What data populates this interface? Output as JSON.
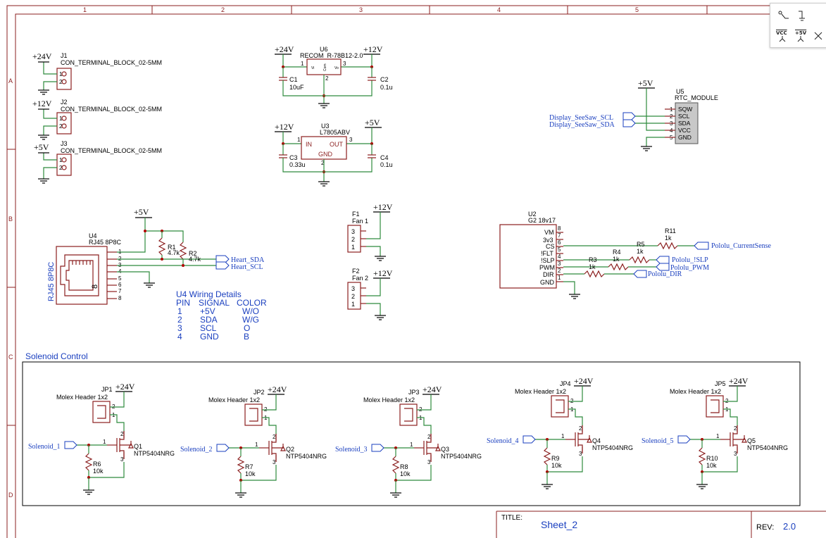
{
  "ruler": {
    "columns": [
      "1",
      "2",
      "3",
      "4",
      "5"
    ],
    "rows": [
      "A",
      "B",
      "C",
      "D"
    ]
  },
  "power_terminals": [
    {
      "ref": "J1",
      "value": "CON_TERMINAL_BLOCK_02-5MM",
      "net": "+24V",
      "pins": [
        "1",
        "2"
      ]
    },
    {
      "ref": "J2",
      "value": "CON_TERMINAL_BLOCK_02-5MM",
      "net": "+12V",
      "pins": [
        "1",
        "2"
      ]
    },
    {
      "ref": "J3",
      "value": "CON_TERMINAL_BLOCK_02-5MM",
      "net": "+5V",
      "pins": [
        "1",
        "2"
      ]
    }
  ],
  "regulator_u6": {
    "ref": "U6",
    "value": "RECOM_R-78B12-2.0",
    "in_net": "+24V",
    "out_net": "+12V",
    "pin_in": "1",
    "pin_out": "3",
    "pin_gnd": "2",
    "pin_label_in": "Vi",
    "pin_label_com": "Com",
    "pin_label_out": "Vo",
    "c_in": {
      "ref": "C1",
      "value": "10uF"
    },
    "c_out": {
      "ref": "C2",
      "value": "0.1u"
    }
  },
  "regulator_u3": {
    "ref": "U3",
    "value": "L7805ABV",
    "in_net": "+12V",
    "out_net": "+5V",
    "pin_in": "1",
    "pin_out": "3",
    "pin_gnd": "2",
    "label_in": "IN",
    "label_out": "OUT",
    "label_gnd": "GND",
    "c_in": {
      "ref": "C3",
      "value": "0.33u"
    },
    "c_out": {
      "ref": "C4",
      "value": "0.1u"
    }
  },
  "rtc": {
    "ref": "U5",
    "value": "RTC_MODULE",
    "net": "+5V",
    "pins": [
      {
        "num": "1",
        "name": "SQW"
      },
      {
        "num": "2",
        "name": "SCL"
      },
      {
        "num": "3",
        "name": "SDA"
      },
      {
        "num": "4",
        "name": "VCC"
      },
      {
        "num": "5",
        "name": "GND"
      }
    ],
    "labels": [
      "Display_SeeSaw_SCL",
      "Display_SeeSaw_SDA"
    ]
  },
  "rj45": {
    "ref": "U4",
    "value": "RJ45 8P8C",
    "side_label": "RJ45 8P8C",
    "body_num": "8",
    "pins": [
      "1",
      "2",
      "3",
      "4",
      "5",
      "6",
      "7",
      "8"
    ],
    "net": "+5V",
    "r1": {
      "ref": "R1",
      "value": "4.7k"
    },
    "r2": {
      "ref": "R2",
      "value": "4.7k"
    },
    "labels": [
      "Heart_SDA",
      "Heart_SCL"
    ]
  },
  "wiring_table": {
    "title": "U4 Wiring Details",
    "headers": [
      "PIN",
      "SIGNAL",
      "COLOR"
    ],
    "rows": [
      [
        "1",
        "+5V",
        "W/O"
      ],
      [
        "2",
        "SDA",
        "W/G"
      ],
      [
        "3",
        "SCL",
        "O"
      ],
      [
        "4",
        "GND",
        "B"
      ]
    ]
  },
  "fans": [
    {
      "ref": "F1",
      "value": "Fan 1",
      "net": "+12V",
      "pins": [
        "3",
        "2",
        "1"
      ]
    },
    {
      "ref": "F2",
      "value": "Fan 2",
      "net": "+12V",
      "pins": [
        "3",
        "2",
        "1"
      ]
    }
  ],
  "driver": {
    "ref": "U2",
    "value": "G2 18v17",
    "pins": [
      {
        "name": "VM",
        "num": "8"
      },
      {
        "name": "3v3",
        "num": "7"
      },
      {
        "name": "CS",
        "num": "6"
      },
      {
        "name": "!FLT",
        "num": "5"
      },
      {
        "name": "!SLP",
        "num": "4"
      },
      {
        "name": "PWM",
        "num": "3"
      },
      {
        "name": "DIR",
        "num": "2"
      },
      {
        "name": "GND",
        "num": "1"
      }
    ],
    "resistors": [
      {
        "ref": "R11",
        "value": "1k"
      },
      {
        "ref": "R5",
        "value": "1k"
      },
      {
        "ref": "R4",
        "value": "1k"
      },
      {
        "ref": "R3",
        "value": "1k"
      }
    ],
    "labels": [
      "Pololu_CurrentSense",
      "Pololu_!SLP",
      "Pololu_PWM",
      "Pololu_DIR"
    ]
  },
  "solenoid_section": {
    "title": "Solenoid Control",
    "channels": [
      {
        "header": "JP1",
        "header_value": "Molex Header 1x2",
        "fet": "Q1",
        "fet_value": "NTP5404NRG",
        "res": "R6",
        "res_value": "10k",
        "label": "Solenoid_1",
        "net": "+24V"
      },
      {
        "header": "JP2",
        "header_value": "Molex Header 1x2",
        "fet": "Q2",
        "fet_value": "NTP5404NRG",
        "res": "R7",
        "res_value": "10k",
        "label": "Solenoid_2",
        "net": "+24V"
      },
      {
        "header": "JP3",
        "header_value": "Molex Header 1x2",
        "fet": "Q3",
        "fet_value": "NTP5404NRG",
        "res": "R8",
        "res_value": "10k",
        "label": "Solenoid_3",
        "net": "+24V"
      },
      {
        "header": "JP4",
        "header_value": "Molex Header 1x2",
        "fet": "Q4",
        "fet_value": "NTP5404NRG",
        "res": "R9",
        "res_value": "10k",
        "label": "Solenoid_4",
        "net": "+24V"
      },
      {
        "header": "JP5",
        "header_value": "Molex Header 1x2",
        "fet": "Q5",
        "fet_value": "NTP5404NRG",
        "res": "R10",
        "res_value": "10k",
        "label": "Solenoid_5",
        "net": "+24V"
      }
    ],
    "pin_nums": [
      "1",
      "2",
      "3"
    ]
  },
  "title_block": {
    "title_label": "TITLE:",
    "title_value": "Sheet_2",
    "rev_label": "REV:",
    "rev_value": "2.0"
  },
  "toolbox": {
    "items": [
      {
        "icon": "net-label-icon"
      },
      {
        "icon": "gnd-flag-icon"
      },
      {
        "icon": "vcc-flag-icon",
        "text": "VCC"
      },
      {
        "icon": "5v-flag-icon",
        "text": "+5V"
      },
      {
        "icon": "no-connect-icon"
      }
    ]
  }
}
